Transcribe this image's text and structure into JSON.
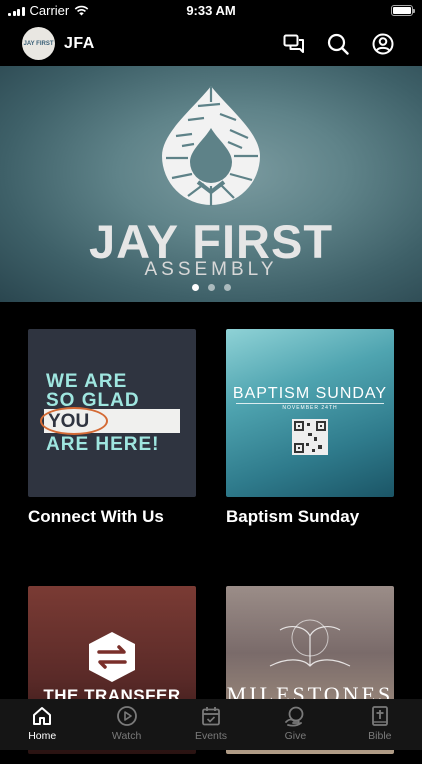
{
  "status_bar": {
    "carrier": "Carrier",
    "time": "9:33 AM"
  },
  "header": {
    "title": "JFA",
    "logo_text": "JAY FIRST",
    "icons": [
      "chat-icon",
      "search-icon",
      "profile-icon"
    ]
  },
  "hero": {
    "title": "JAY FIRST",
    "subtitle": "ASSEMBLY",
    "slide_count": 3,
    "active_slide": 1
  },
  "cards": [
    {
      "caption": "Connect With Us",
      "art_lines": [
        "WE ARE",
        "SO GLAD",
        "YOU",
        "ARE HERE!"
      ]
    },
    {
      "caption": "Baptism Sunday",
      "art_title": "BAPTISM SUNDAY",
      "art_subtitle": "NOVEMBER 24TH"
    },
    {
      "caption": "",
      "art_title": "THE TRANSFER"
    },
    {
      "caption": "",
      "art_title": "MILESTONES"
    }
  ],
  "tabs": [
    {
      "label": "Home",
      "icon": "home-icon",
      "active": true
    },
    {
      "label": "Watch",
      "icon": "play-icon",
      "active": false
    },
    {
      "label": "Events",
      "icon": "calendar-icon",
      "active": false
    },
    {
      "label": "Give",
      "icon": "give-icon",
      "active": false
    },
    {
      "label": "Bible",
      "icon": "bible-icon",
      "active": false
    }
  ],
  "colors": {
    "background": "#000000",
    "tabbar": "#151515",
    "tab_active": "#ffffff",
    "tab_inactive": "#7a7a7a",
    "welcome_text": "#9fe6e0",
    "accent_orange": "#d46a34"
  }
}
